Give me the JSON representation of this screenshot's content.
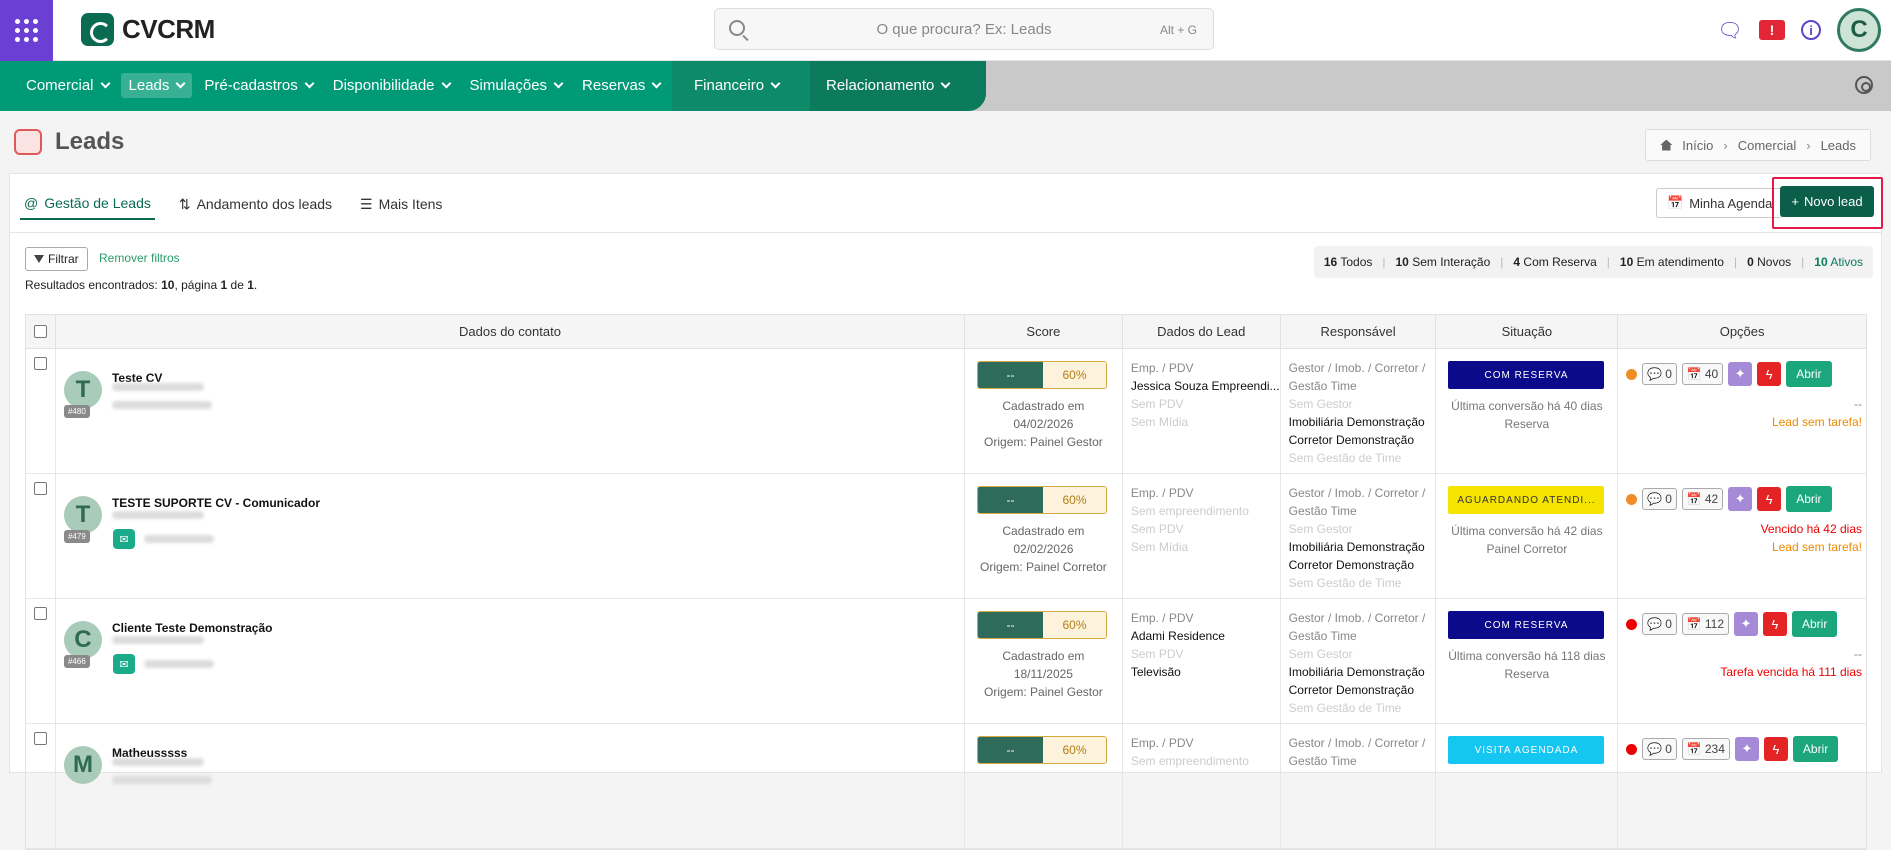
{
  "app": {
    "brand": "CVCRM"
  },
  "search": {
    "placeholder": "O que procura? Ex: Leads",
    "shortcut": "Alt + G"
  },
  "user": {
    "initial": "C"
  },
  "nav": {
    "items": [
      "Comercial",
      "Leads",
      "Pré-cadastros",
      "Disponibilidade",
      "Simulações",
      "Reservas"
    ],
    "financeiro": "Financeiro",
    "relacionamento": "Relacionamento"
  },
  "page": {
    "title": "Leads"
  },
  "breadcrumb": [
    "Início",
    "Comercial",
    "Leads"
  ],
  "tabs": [
    "Gestão de Leads",
    "Andamento dos leads",
    "Mais Itens"
  ],
  "buttons": {
    "agenda": "Minha Agenda",
    "new_lead": "Novo lead",
    "filter": "Filtrar",
    "remove_filters": "Remover filtros"
  },
  "results": {
    "prefix": "Resultados encontrados: ",
    "count": "10",
    "mid": ", página ",
    "page": "1",
    "of": " de ",
    "total": "1",
    "end": "."
  },
  "counts": [
    {
      "n": "16",
      "label": "Todos"
    },
    {
      "n": "10",
      "label": "Sem Interação"
    },
    {
      "n": "4",
      "label": "Com Reserva"
    },
    {
      "n": "10",
      "label": "Em atendimento"
    },
    {
      "n": "0",
      "label": "Novos"
    },
    {
      "n": "10",
      "label": "Ativos"
    }
  ],
  "columns": [
    "Dados do contato",
    "Score",
    "Dados do Lead",
    "Responsável",
    "Situação",
    "Opções"
  ],
  "rows": [
    {
      "initial": "T",
      "id": "#480",
      "name": "Teste CV",
      "whatsapp": false,
      "score_a": "--",
      "score_b": "60%",
      "score_lines": [
        "Cadastrado em",
        "04/02/2026",
        "Origem: Painel Gestor"
      ],
      "lead": {
        "label": "Emp. / PDV",
        "emp": "Jessica Souza Empreendi...",
        "emp_gray": false,
        "pdv": "Sem PDV",
        "midia": "Sem Mídia",
        "midia_gray": true
      },
      "resp": {
        "label1": "Gestor / Imob. / Corretor /",
        "label2": "Gestão Time",
        "gestor": "Sem Gestor",
        "imob": "Imobiliária Demonstração",
        "corretor": "Corretor Demonstração",
        "time": "Sem Gestão de Time"
      },
      "situacao": {
        "text": "COM RESERVA",
        "style": "navy",
        "line1": "Última conversão há 40 dias",
        "line2": "Reserva"
      },
      "opts": {
        "dot": "orange",
        "chat": "0",
        "cal": "40",
        "lines": [
          {
            "t": "--",
            "c": "gray"
          },
          {
            "t": "Lead sem tarefa!",
            "c": "orangeT"
          }
        ]
      }
    },
    {
      "initial": "T",
      "id": "#479",
      "name": "TESTE SUPORTE CV - Comunicador",
      "whatsapp": true,
      "score_a": "--",
      "score_b": "60%",
      "score_lines": [
        "Cadastrado em",
        "02/02/2026",
        "Origem: Painel Corretor"
      ],
      "lead": {
        "label": "Emp. / PDV",
        "emp": "Sem empreendimento",
        "emp_gray": true,
        "pdv": "Sem PDV",
        "midia": "Sem Mídia",
        "midia_gray": true
      },
      "resp": {
        "label1": "Gestor / Imob. / Corretor /",
        "label2": "Gestão Time",
        "gestor": "Sem Gestor",
        "imob": "Imobiliária Demonstração",
        "corretor": "Corretor Demonstração",
        "time": "Sem Gestão de Time"
      },
      "situacao": {
        "text": "AGUARDANDO ATENDI...",
        "style": "yellow",
        "line1": "Última conversão há 42 dias",
        "line2": "Painel Corretor"
      },
      "opts": {
        "dot": "orange",
        "chat": "0",
        "cal": "42",
        "lines": [
          {
            "t": "Vencido há 42 dias",
            "c": "redT"
          },
          {
            "t": "Lead sem tarefa!",
            "c": "orangeT"
          }
        ]
      }
    },
    {
      "initial": "C",
      "id": "#466",
      "name": "Cliente Teste Demonstração",
      "whatsapp": true,
      "score_a": "--",
      "score_b": "60%",
      "score_lines": [
        "Cadastrado em",
        "18/11/2025",
        "Origem: Painel Gestor"
      ],
      "lead": {
        "label": "Emp. / PDV",
        "emp": "Adami Residence",
        "emp_gray": false,
        "pdv": "Sem PDV",
        "midia": "Televisão",
        "midia_gray": false
      },
      "resp": {
        "label1": "Gestor / Imob. / Corretor /",
        "label2": "Gestão Time",
        "gestor": "Sem Gestor",
        "imob": "Imobiliária Demonstração",
        "corretor": "Corretor Demonstração",
        "time": "Sem Gestão de Time"
      },
      "situacao": {
        "text": "COM RESERVA",
        "style": "navy",
        "line1": "Última conversão há 118 dias",
        "line2": "Reserva"
      },
      "opts": {
        "dot": "red",
        "chat": "0",
        "cal": "112",
        "lines": [
          {
            "t": "--",
            "c": "gray"
          },
          {
            "t": "Tarefa vencida há 111 dias",
            "c": "redT"
          }
        ]
      }
    },
    {
      "initial": "M",
      "id": "",
      "name": "Matheusssss",
      "whatsapp": false,
      "score_a": "--",
      "score_b": "60%",
      "score_lines": [
        "",
        "",
        ""
      ],
      "lead": {
        "label": "Emp. / PDV",
        "emp": "Sem empreendimento",
        "emp_gray": true,
        "pdv": "",
        "midia": "",
        "midia_gray": true
      },
      "resp": {
        "label1": "Gestor / Imob. / Corretor /",
        "label2": "Gestão Time",
        "gestor": "",
        "imob": "",
        "corretor": "",
        "time": ""
      },
      "situacao": {
        "text": "VISITA AGENDADA",
        "style": "cyan",
        "line1": "",
        "line2": ""
      },
      "opts": {
        "dot": "red",
        "chat": "0",
        "cal": "234",
        "lines": []
      }
    }
  ],
  "abrir": "Abrir"
}
